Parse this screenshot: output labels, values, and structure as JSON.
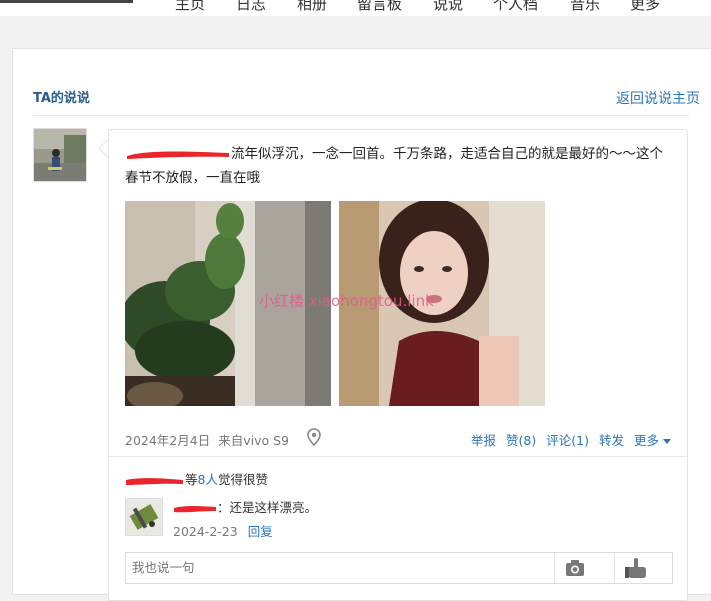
{
  "nav": {
    "items": [
      "主页",
      "日志",
      "相册",
      "留言板",
      "说说",
      "个人档",
      "音乐",
      "更多"
    ]
  },
  "section": {
    "title": "TA的说说",
    "back_link": "返回说说主页"
  },
  "post": {
    "text": "流年似浮沉，一念一回首。千万条路，走适合自己的就是最好的～～这个春节不放假，一直在哦",
    "photos": [
      "plants-and-column-photo",
      "woman-selfie-photo"
    ],
    "watermark": "小红楼 xiaohongtou.link",
    "date": "2024年2月4日",
    "source": "来自vivo S9",
    "actions": {
      "report": "举报",
      "like": "赞(8)",
      "comment": "评论(1)",
      "forward": "转发",
      "more": "更多"
    }
  },
  "likes": {
    "count_text": "8人",
    "prefix": "等",
    "suffix": "觉得很赞"
  },
  "comment": {
    "text": "：还是这样漂亮。",
    "date": "2024-2-23",
    "reply": "回复"
  },
  "reply_input": {
    "placeholder": "我也说一句"
  },
  "colors": {
    "link": "#2b76b9",
    "section_title": "#2b5d8c",
    "redaction": "#e8262b",
    "watermark": "#e05a8d"
  },
  "icons": [
    "location-pin-icon",
    "camera-icon",
    "hand-point-icon",
    "chevron-down-icon"
  ]
}
